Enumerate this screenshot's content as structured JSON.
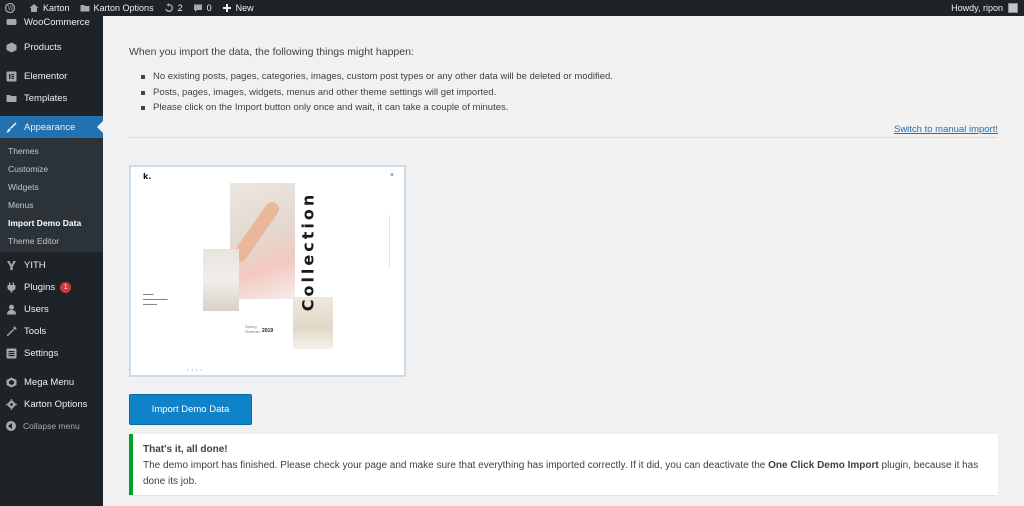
{
  "adminbar": {
    "site_name": "Karton",
    "theme_options": "Karton Options",
    "updates_count": "2",
    "comments_count": "0",
    "new_label": "New",
    "greeting": "Howdy, ripon"
  },
  "sidebar": {
    "items_top": [
      {
        "label": "WooCommerce",
        "icon": "woocommerce-icon"
      },
      {
        "label": "Products",
        "icon": "products-icon"
      },
      {
        "label": "Elementor",
        "icon": "elementor-icon"
      },
      {
        "label": "Templates",
        "icon": "folder-icon"
      },
      {
        "label": "Appearance",
        "icon": "brush-icon"
      }
    ],
    "appearance_sub": [
      {
        "label": "Themes"
      },
      {
        "label": "Customize"
      },
      {
        "label": "Widgets"
      },
      {
        "label": "Menus"
      },
      {
        "label": "Import Demo Data"
      },
      {
        "label": "Theme Editor"
      }
    ],
    "items_bottom": [
      {
        "label": "YITH",
        "icon": "yith-icon"
      },
      {
        "label": "Plugins",
        "icon": "plugins-icon",
        "badge": "1"
      },
      {
        "label": "Users",
        "icon": "users-icon"
      },
      {
        "label": "Tools",
        "icon": "tools-icon"
      },
      {
        "label": "Settings",
        "icon": "settings-icon"
      },
      {
        "label": "Mega Menu",
        "icon": "mega-menu-icon"
      },
      {
        "label": "Karton Options",
        "icon": "gear-icon"
      }
    ],
    "collapse_label": "Collapse menu"
  },
  "main": {
    "intro": "When you import the data, the following things might happen:",
    "bullets": [
      "No existing posts, pages, categories, images, custom post types or any other data will be deleted or modified.",
      "Posts, pages, images, widgets, menus and other theme settings will get imported.",
      "Please click on the Import button only once and wait, it can take a couple of minutes."
    ],
    "manual_link": "Switch to manual import!",
    "preview": {
      "logo": "k.",
      "close": "×",
      "word": "Collection",
      "spring": "Spring",
      "summer": "Summer",
      "year": "2019",
      "dots": "• • • •"
    },
    "import_button": "Import Demo Data",
    "notice": {
      "title": "That's it, all done!",
      "text_before": "The demo import has finished. Please check your page and make sure that everything has imported correctly. If it did, you can deactivate the ",
      "plugin_name": "One Click Demo Import",
      "text_after": " plugin, because it has done its job."
    }
  },
  "colors": {
    "sidebar_bg": "#1d2327",
    "accent": "#2271b1",
    "button": "#0f83c7",
    "success": "#00a32a"
  }
}
